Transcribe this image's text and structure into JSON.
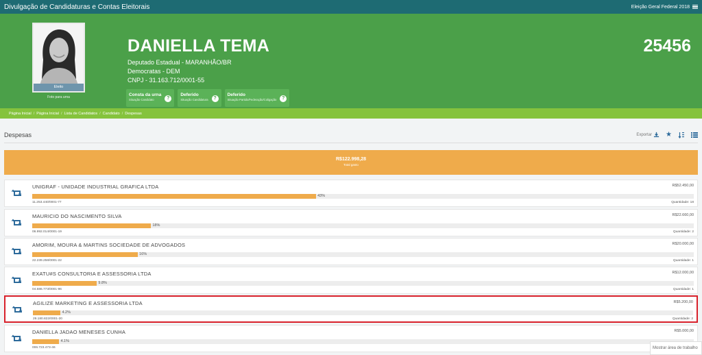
{
  "topbar": {
    "title": "Divulgação de Candidaturas e Contas Eleitorais",
    "election": "Eleição Geral Federal 2018"
  },
  "candidate": {
    "name": "DANIELLA TEMA",
    "office": "Deputado Estadual - MARANHÃO/BR",
    "party": "Democratas - DEM",
    "cnpj": "CNPJ - 31.163.712/0001-55",
    "number": "25456",
    "photo_status": "Eleito",
    "photo_caption": "Foto para urna"
  },
  "status_boxes": [
    {
      "title": "Consta da urna",
      "subtitle": "Situação Candidato",
      "help": "?"
    },
    {
      "title": "Deferido",
      "subtitle": "Situação Candidatura",
      "help": "?"
    },
    {
      "title": "Deferido",
      "subtitle": "Situação Partido/Federação/Coligação",
      "help": "?"
    }
  ],
  "breadcrumb": [
    "Página Inicial",
    "Página Inicial",
    "Lista de Candidatos",
    "Candidato",
    "Despesas"
  ],
  "section": {
    "title": "Despesas",
    "export_label": "Exportar"
  },
  "total": {
    "value": "R$122.998,28",
    "label": "Total gasto"
  },
  "expenses": [
    {
      "name": "UNIGRAF - UNIDADE INDUSTRIAL GRAFICA LTDA",
      "amount": "R$52.450,00",
      "pct": "43%",
      "pct_value": 0.43,
      "cnpj": "11.253.440/0001-77",
      "qty": "Quantidade: 18"
    },
    {
      "name": "MAURICIO DO NASCIMENTO SILVA",
      "amount": "R$22.660,00",
      "pct": "18%",
      "pct_value": 0.18,
      "cnpj": "06.992.014/0001-19",
      "qty": "Quantidade: 2"
    },
    {
      "name": "AMORIM, MOURA & MARTINS SOCIEDADE DE ADVOGADOS",
      "amount": "R$20.000,00",
      "pct": "16%",
      "pct_value": 0.16,
      "cnpj": "22.239.258/0001-22",
      "qty": "Quantidade: 1"
    },
    {
      "name": "EXATU#S CONSULTORIA E ASSESSORIA LTDA",
      "amount": "R$12.000,00",
      "pct": "9.8%",
      "pct_value": 0.098,
      "cnpj": "04.686.773/0001-96",
      "qty": "Quantidade: 1"
    },
    {
      "name": "AGILIZE MARKETING E ASSESSORIA LTDA",
      "amount": "R$5.200,00",
      "pct": "4.2%",
      "pct_value": 0.042,
      "cnpj": "29.180.822/0001-20",
      "qty": "Quantidade: 2"
    },
    {
      "name": "DANIELLA JADAO MENESES CUNHA",
      "amount": "R$5.000,00",
      "pct": "4.1%",
      "pct_value": 0.041,
      "cnpj": "006.723.473-46",
      "qty": ""
    }
  ],
  "overlay_tip": "Mostrar área de trabalho",
  "colors": {
    "topbar": "#1e6b73",
    "hero": "#4ba049",
    "breadcrumb": "#85c33d",
    "accent_orange": "#efab4b",
    "highlight": "#d8202a"
  }
}
